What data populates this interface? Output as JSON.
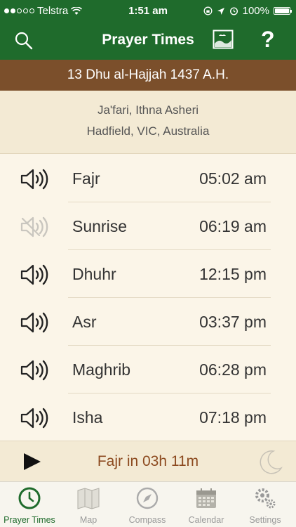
{
  "status_bar": {
    "carrier": "Telstra",
    "time": "1:51 am",
    "battery": "100%",
    "signal_dots_filled": 2,
    "signal_dots_total": 5
  },
  "nav": {
    "title": "Prayer Times",
    "help": "?"
  },
  "hijri_date": "13 Dhu al-Hajjah 1437 A.H.",
  "info": {
    "method": "Ja'fari, Ithna Asheri",
    "location": "Hadfield, VIC, Australia"
  },
  "prayers": [
    {
      "name": "Fajr",
      "time": "05:02 am",
      "sound_on": true
    },
    {
      "name": "Sunrise",
      "time": "06:19 am",
      "sound_on": false
    },
    {
      "name": "Dhuhr",
      "time": "12:15 pm",
      "sound_on": true
    },
    {
      "name": "Asr",
      "time": "03:37 pm",
      "sound_on": true
    },
    {
      "name": "Maghrib",
      "time": "06:28 pm",
      "sound_on": true
    },
    {
      "name": "Isha",
      "time": "07:18 pm",
      "sound_on": true
    }
  ],
  "countdown": {
    "text": "Fajr in 03h  11m"
  },
  "tabs": [
    {
      "label": "Prayer Times",
      "icon": "clock-icon",
      "active": true
    },
    {
      "label": "Map",
      "icon": "map-icon",
      "active": false
    },
    {
      "label": "Compass",
      "icon": "compass-icon",
      "active": false
    },
    {
      "label": "Calendar",
      "icon": "calendar-icon",
      "active": false
    },
    {
      "label": "Settings",
      "icon": "gears-icon",
      "active": false
    }
  ],
  "colors": {
    "primary_green": "#1f6b2c",
    "date_brown": "#7b4f2b",
    "countdown_text": "#8c4a1f",
    "background": "#fbf5e8"
  }
}
